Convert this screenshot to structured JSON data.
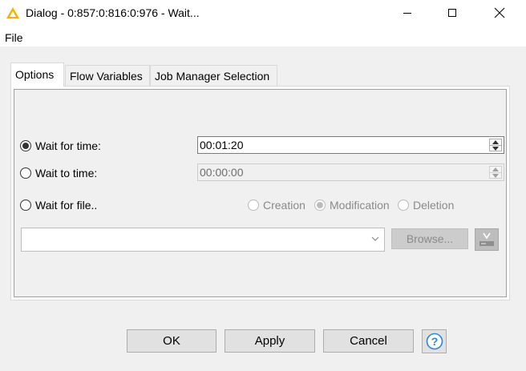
{
  "window": {
    "title": "Dialog - 0:857:0:816:0:976 - Wait...",
    "controls": [
      "minimize",
      "maximize",
      "close"
    ]
  },
  "menu": {
    "file": "File"
  },
  "tabs": [
    {
      "label": "Options",
      "active": true
    },
    {
      "label": "Flow Variables",
      "active": false
    },
    {
      "label": "Job Manager Selection",
      "active": false
    }
  ],
  "options": {
    "wait_for_time": {
      "label": "Wait for time:",
      "selected": true,
      "value": "00:01:20"
    },
    "wait_to_time": {
      "label": "Wait to time:",
      "selected": false,
      "value": "00:00:00",
      "disabled": true
    },
    "wait_for_file": {
      "label": "Wait for file..",
      "selected": false
    },
    "file_event": {
      "creation": {
        "label": "Creation",
        "selected": false
      },
      "modification": {
        "label": "Modification",
        "selected": true
      },
      "deletion": {
        "label": "Deletion",
        "selected": false
      }
    },
    "file_combo": {
      "value": ""
    },
    "browse_label": "Browse..."
  },
  "buttons": {
    "ok": "OK",
    "apply": "Apply",
    "cancel": "Cancel"
  },
  "icons": {
    "app": "warning-triangle-icon",
    "variable": "flow-variable-icon",
    "help": "help-icon"
  },
  "colors": {
    "warning": "#f5b400",
    "help_blue": "#2a86d9"
  }
}
